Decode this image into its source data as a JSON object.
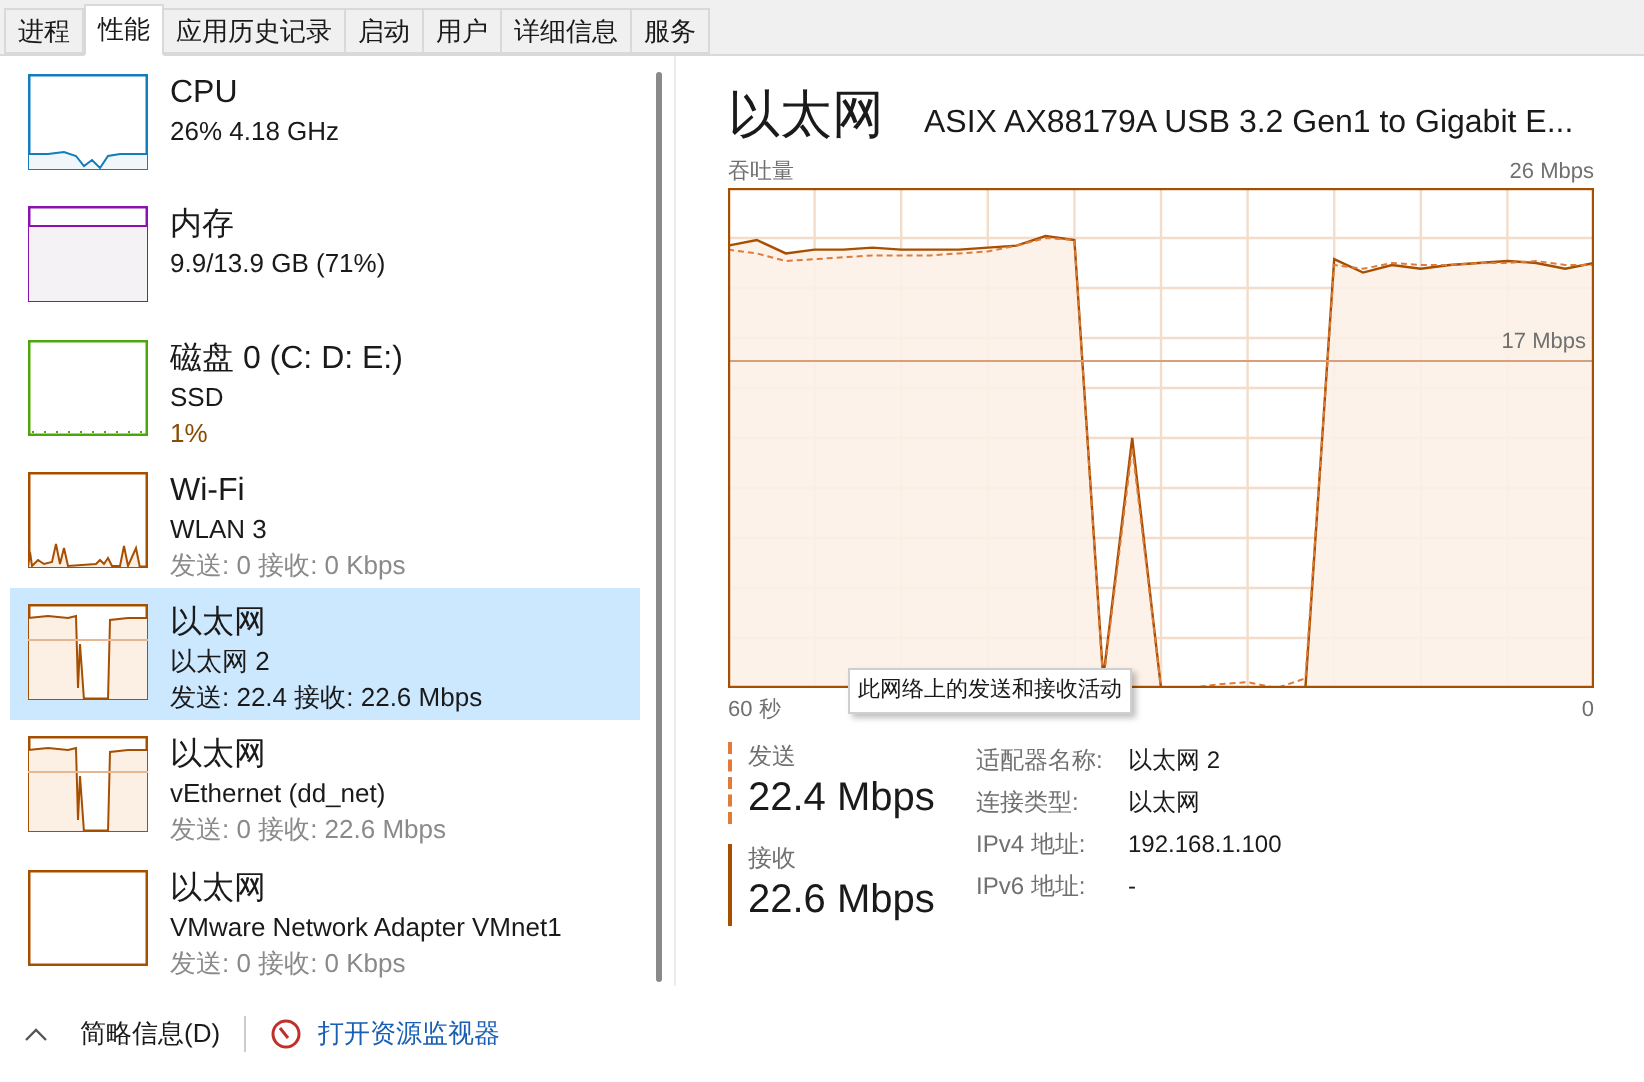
{
  "tabs": [
    {
      "label": "进程",
      "selected": false
    },
    {
      "label": "性能",
      "selected": true
    },
    {
      "label": "应用历史记录",
      "selected": false
    },
    {
      "label": "启动",
      "selected": false
    },
    {
      "label": "用户",
      "selected": false
    },
    {
      "label": "详细信息",
      "selected": false
    },
    {
      "label": "服务",
      "selected": false
    }
  ],
  "sidebar": {
    "items": [
      {
        "kind": "cpu",
        "color": "#117dbb",
        "title": "CPU",
        "lines": [
          "26% 4.18 GHz"
        ],
        "selected": false
      },
      {
        "kind": "memory",
        "color": "#8b12ae",
        "title": "内存",
        "lines": [
          "9.9/13.9 GB (71%)"
        ],
        "selected": false
      },
      {
        "kind": "disk",
        "color": "#4da60c",
        "title": "磁盘 0 (C: D: E:)",
        "lines": [
          "SSD",
          "1%"
        ],
        "selected": false
      },
      {
        "kind": "wifi",
        "color": "#a74f01",
        "title": "Wi-Fi",
        "lines": [
          "WLAN 3",
          "发送: 0 接收: 0 Kbps"
        ],
        "selected": false
      },
      {
        "kind": "ethernet",
        "color": "#a74f01",
        "title": "以太网",
        "lines": [
          "以太网 2",
          "发送: 22.4 接收: 22.6 Mbps"
        ],
        "selected": true
      },
      {
        "kind": "ethernet",
        "color": "#a74f01",
        "title": "以太网",
        "lines": [
          "vEthernet (dd_net)",
          "发送: 0 接收: 22.6 Mbps"
        ],
        "selected": false
      },
      {
        "kind": "idle",
        "color": "#a74f01",
        "title": "以太网",
        "lines": [
          "VMware Network Adapter VMnet1",
          "发送: 0 接收: 0 Kbps"
        ],
        "selected": false
      }
    ]
  },
  "detail": {
    "title": "以太网",
    "adapter": "ASIX AX88179A USB 3.2 Gen1 to Gigabit E...",
    "graph": {
      "label": "吞吐量",
      "max": "26 Mbps",
      "reference": "17 Mbps",
      "time_start": "60 秒",
      "time_end": "0"
    },
    "tooltip": "此网络上的发送和接收活动",
    "stats": [
      {
        "kind": "send",
        "label": "发送",
        "value": "22.4 Mbps"
      },
      {
        "kind": "receive",
        "label": "接收",
        "value": "22.6 Mbps"
      }
    ],
    "properties": [
      {
        "label": "适配器名称:",
        "value": "以太网 2"
      },
      {
        "label": "连接类型:",
        "value": "以太网"
      },
      {
        "label": "IPv4 地址:",
        "value": "192.168.1.100"
      },
      {
        "label": "IPv6 地址:",
        "value": "-"
      }
    ]
  },
  "footer": {
    "collapse": "简略信息(D)",
    "monitor_link": "打开资源监视器"
  }
}
